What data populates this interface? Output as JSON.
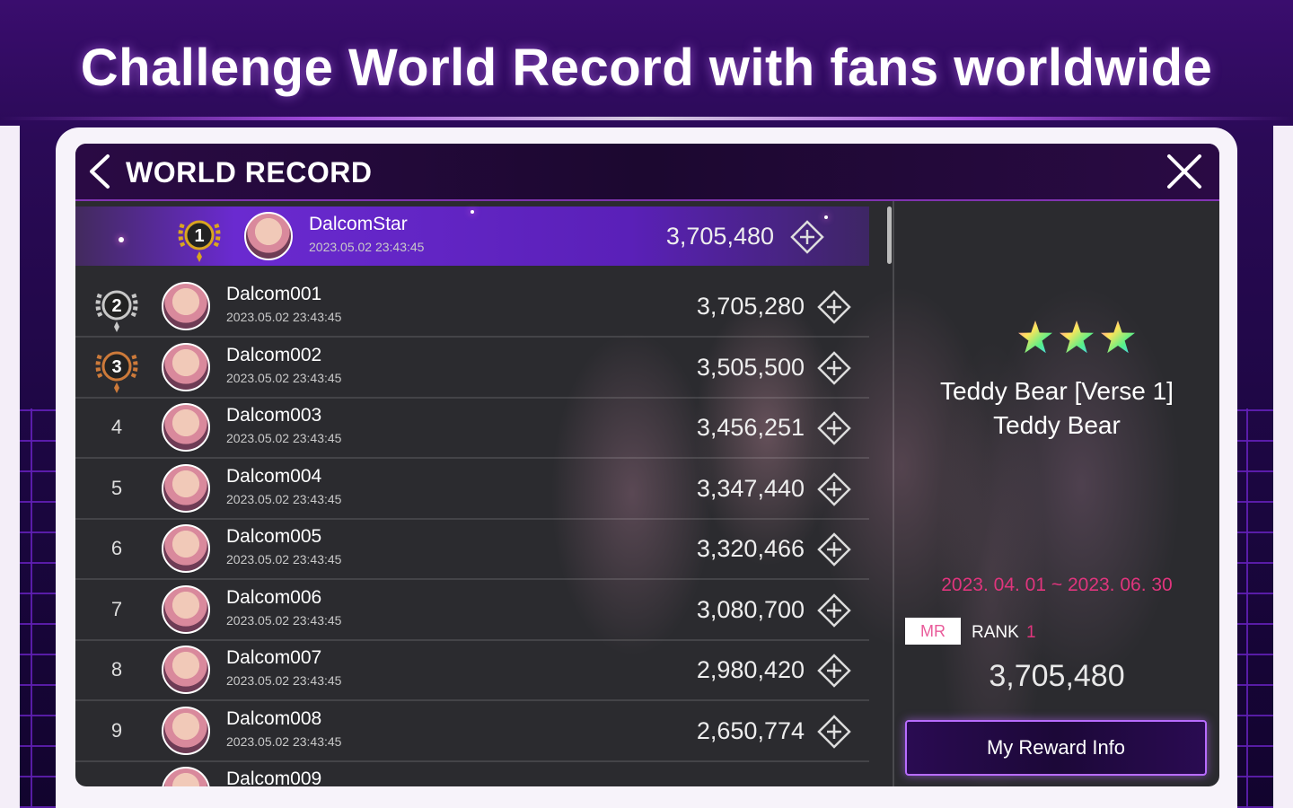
{
  "headline": "Challenge World Record with fans worldwide",
  "topbar": {
    "title": "WORLD RECORD"
  },
  "records": [
    {
      "rank": "1",
      "name": "DalcomStar",
      "date": "2023.05.02 23:43:45",
      "score": "3,705,480"
    },
    {
      "rank": "2",
      "name": "Dalcom001",
      "date": "2023.05.02 23:43:45",
      "score": "3,705,280"
    },
    {
      "rank": "3",
      "name": "Dalcom002",
      "date": "2023.05.02 23:43:45",
      "score": "3,505,500"
    },
    {
      "rank": "4",
      "name": "Dalcom003",
      "date": "2023.05.02 23:43:45",
      "score": "3,456,251"
    },
    {
      "rank": "5",
      "name": "Dalcom004",
      "date": "2023.05.02 23:43:45",
      "score": "3,347,440"
    },
    {
      "rank": "6",
      "name": "Dalcom005",
      "date": "2023.05.02 23:43:45",
      "score": "3,320,466"
    },
    {
      "rank": "7",
      "name": "Dalcom006",
      "date": "2023.05.02 23:43:45",
      "score": "3,080,700"
    },
    {
      "rank": "8",
      "name": "Dalcom007",
      "date": "2023.05.02 23:43:45",
      "score": "2,980,420"
    },
    {
      "rank": "9",
      "name": "Dalcom008",
      "date": "2023.05.02 23:43:45",
      "score": "2,650,774"
    },
    {
      "rank": "",
      "name": "Dalcom009",
      "date": "",
      "score": ""
    }
  ],
  "song": {
    "title": "Teddy Bear [Verse 1]",
    "artist": "Teddy Bear",
    "period": "2023. 04. 01 ~ 2023. 06. 30",
    "star_count": 3
  },
  "my_record": {
    "mode_badge": "MR",
    "rank_label": "RANK",
    "rank_value": "1",
    "score": "3,705,480"
  },
  "reward_button": {
    "label": "My Reward Info"
  },
  "colors": {
    "accent_pink": "#e0357d",
    "first_row_purple": "#6a2ad0",
    "gold": "#d9a520",
    "silver": "#c8c8c8",
    "bronze": "#cd7a3a"
  },
  "icons": {
    "back": "chevron-left-icon",
    "close": "close-icon",
    "row_action": "plus-diamond-icon",
    "medal": "laurel-medal-icon",
    "star": "star-icon"
  }
}
